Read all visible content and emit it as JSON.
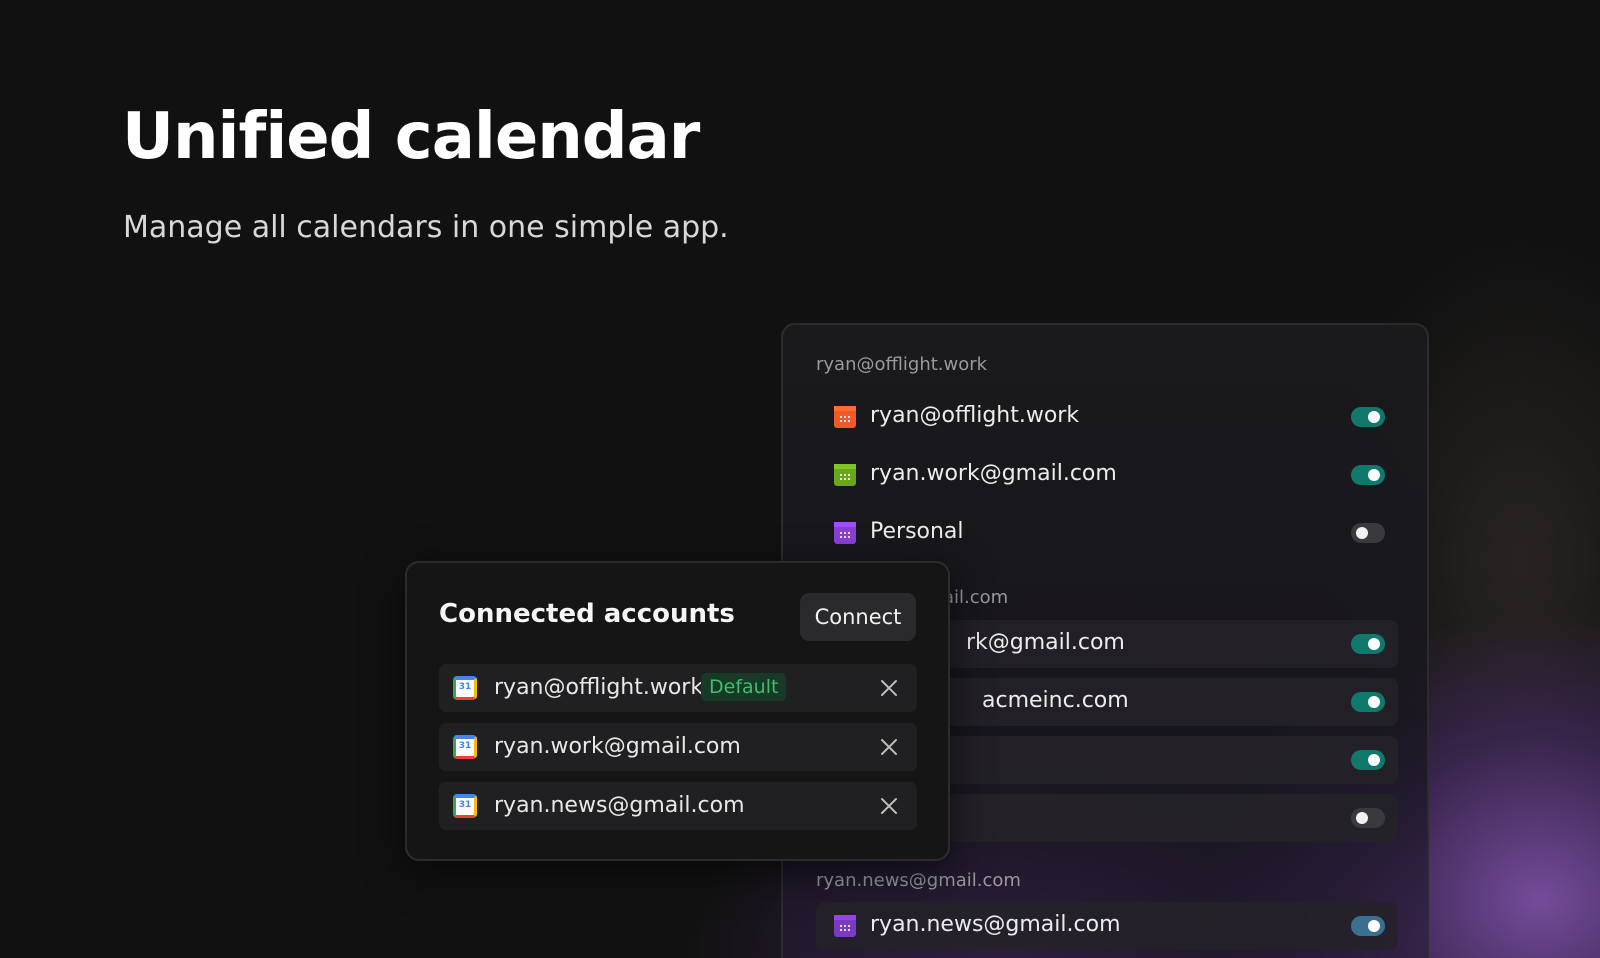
{
  "hero": {
    "title": "Unified calendar",
    "subtitle": "Manage all calendars in one simple app."
  },
  "calendars_panel": {
    "groups": [
      {
        "label": "ryan@offlight.work",
        "calendars": [
          {
            "name": "ryan@offlight.work",
            "color": "#f05a28",
            "enabled": true
          },
          {
            "name": "ryan.work@gmail.com",
            "color": "#6aa51f",
            "enabled": true
          },
          {
            "name": "Personal",
            "color": "#8a3fd6",
            "enabled": false
          }
        ]
      },
      {
        "label": "ail.com",
        "calendars": [
          {
            "name": "rk@gmail.com",
            "enabled": true
          },
          {
            "name": "acmeinc.com",
            "enabled": true
          },
          {
            "name": "",
            "enabled": true
          },
          {
            "name": "",
            "enabled": false
          }
        ]
      },
      {
        "label": "ryan.news@gmail.com",
        "calendars": [
          {
            "name": "ryan.news@gmail.com",
            "color": "#8a3fd6",
            "enabled": true
          }
        ]
      }
    ]
  },
  "accounts_card": {
    "title": "Connected accounts",
    "connect_label": "Connect",
    "calendar_icon_text": "31",
    "accounts": [
      {
        "email": "ryan@offlight.work",
        "badge": "Default"
      },
      {
        "email": "ryan.work@gmail.com"
      },
      {
        "email": "ryan.news@gmail.com"
      }
    ]
  },
  "colors": {
    "background": "#111111",
    "toggle_on": "#11786c",
    "toggle_off": "#3a3a3e",
    "badge_text": "#3fbf6a",
    "glow": "#965fc8"
  }
}
